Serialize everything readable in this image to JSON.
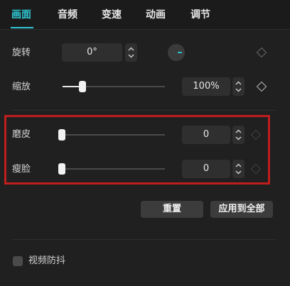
{
  "tabs": [
    {
      "label": "画面",
      "active": true
    },
    {
      "label": "音频",
      "active": false
    },
    {
      "label": "变速",
      "active": false
    },
    {
      "label": "动画",
      "active": false
    },
    {
      "label": "调节",
      "active": false
    }
  ],
  "rotate": {
    "label": "旋转",
    "value": "0°"
  },
  "scale": {
    "label": "缩放",
    "value": "100%",
    "slider_level": 0.2
  },
  "smooth": {
    "label": "磨皮",
    "value": "0",
    "slider_level": 0
  },
  "slim_face": {
    "label": "瘦脸",
    "value": "0",
    "slider_level": 0
  },
  "buttons": {
    "reset": "重置",
    "apply_all": "应用到全部"
  },
  "stabilize": {
    "label": "视频防抖",
    "checked": false
  },
  "colors": {
    "accent": "#2ec9d6",
    "panel_bg": "#202020",
    "highlight": "#c01d1d"
  }
}
